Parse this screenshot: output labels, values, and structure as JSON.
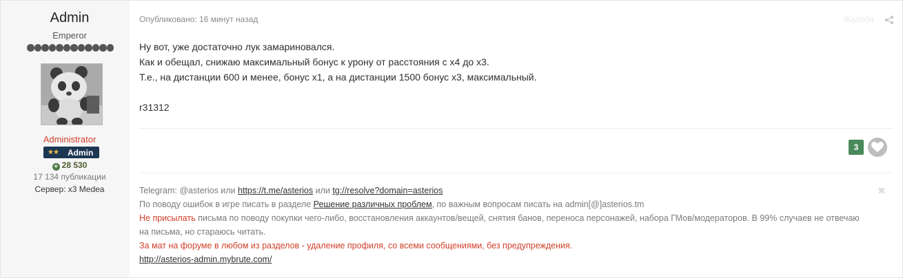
{
  "author": {
    "name": "Admin",
    "title": "Emperor",
    "rank_pips": 12,
    "group": "Administrator",
    "badge_label": "Admin",
    "badge_stars": "★★",
    "reputation": "28 530",
    "posts": "17 134 публикации",
    "server": "Сервер: x3 Medea"
  },
  "post": {
    "published": "Опубликовано: 16 минут назад",
    "report_label": "Жалоба",
    "body": [
      "Ну вот, уже достаточно лук замариновался.",
      "Как и обещал, снижаю максимальный бонус к урону от расстояния с х4 до х3.",
      "Т.е., на дистанции 600 и менее, бонус х1, а на дистанции 1500 бонус х3, максимальный."
    ],
    "body_tail": "r31312",
    "like_count": "3"
  },
  "signature": {
    "line1_prefix": "Telegram: @asterios или ",
    "line1_link1": "https://t.me/asterios",
    "line1_mid": " или ",
    "line1_link2": "tg://resolve?domain=asterios",
    "line2_prefix": "По поводу ошибок в игре писать в разделе ",
    "line2_link": "Решение различных проблем",
    "line2_suffix": ", по важным вопросам писать на admin[@]asterios.tm",
    "line3_red": "Не присылать",
    "line3_rest": " письма по поводу покупки чего-либо, восстановления аккаунтов/вещей, снятия банов, переноса персонажей, набора ГМов/модераторов. В 99% случаев не отвечаю на письма, но стараюсь читать.",
    "line4": "За мат на форуме в любом из разделов - удаление профиля, со всеми сообщениями, без предупреждения.",
    "line5_link": "http://asterios-admin.mybrute.com/"
  },
  "colors": {
    "group_red": "#d0402a",
    "badge_bg": "#1d3652",
    "like_green": "#4a8a5a"
  }
}
